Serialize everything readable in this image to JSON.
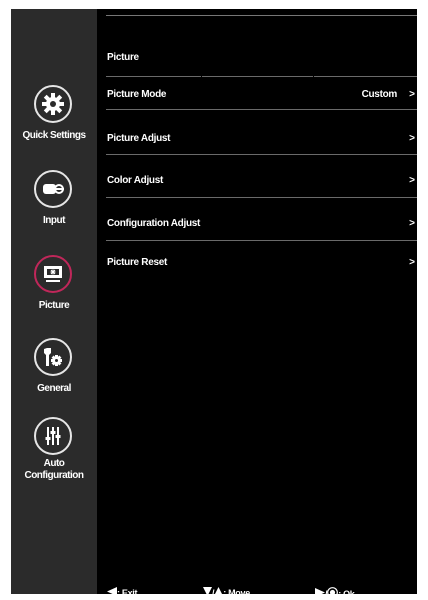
{
  "sidebar": {
    "items": [
      {
        "label": "Quick Settings",
        "icon": "gear-icon",
        "active": false
      },
      {
        "label": "Input",
        "icon": "input-plug-icon",
        "active": false
      },
      {
        "label": "Picture",
        "icon": "monitor-icon",
        "active": true
      },
      {
        "label": "General",
        "icon": "tools-icon",
        "active": false
      },
      {
        "label_line1": "Auto",
        "label_line2": "Configuration",
        "icon": "sliders-icon",
        "active": false
      }
    ],
    "active_color": "#c0275a"
  },
  "menu": {
    "title": "Picture",
    "items": [
      {
        "label": "Picture Mode",
        "value": "Custom",
        "arrow": ">"
      },
      {
        "label": "Picture Adjust",
        "value": "",
        "arrow": ">"
      },
      {
        "label": "Color Adjust",
        "value": "",
        "arrow": ">"
      },
      {
        "label": "Configuration Adjust",
        "value": "",
        "arrow": ">"
      },
      {
        "label": "Picture Reset",
        "value": "",
        "arrow": ">"
      }
    ]
  },
  "footer": {
    "exit": ": Exit",
    "move": ": Move",
    "ok": ": Ok",
    "slash": "/"
  }
}
